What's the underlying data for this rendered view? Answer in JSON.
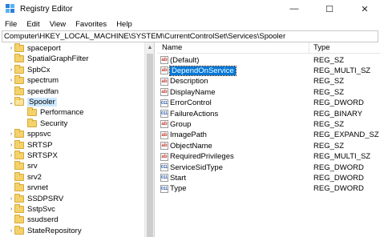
{
  "window": {
    "title": "Registry Editor",
    "minimize": "—",
    "maximize": "☐",
    "close": "✕"
  },
  "menu": [
    "File",
    "Edit",
    "View",
    "Favorites",
    "Help"
  ],
  "address": "Computer\\HKEY_LOCAL_MACHINE\\SYSTEM\\CurrentControlSet\\Services\\Spooler",
  "tree": [
    {
      "label": "spaceport",
      "chevron": "›",
      "indent": 0
    },
    {
      "label": "SpatialGraphFilter",
      "chevron": "",
      "indent": 0
    },
    {
      "label": "SpbCx",
      "chevron": "›",
      "indent": 0
    },
    {
      "label": "spectrum",
      "chevron": "›",
      "indent": 0
    },
    {
      "label": "speedfan",
      "chevron": "",
      "indent": 0
    },
    {
      "label": "Spooler",
      "chevron": "⌄",
      "indent": 0,
      "selected": true
    },
    {
      "label": "Performance",
      "chevron": "",
      "indent": 1
    },
    {
      "label": "Security",
      "chevron": "",
      "indent": 1
    },
    {
      "label": "sppsvc",
      "chevron": "›",
      "indent": 0
    },
    {
      "label": "SRTSP",
      "chevron": "›",
      "indent": 0
    },
    {
      "label": "SRTSPX",
      "chevron": "›",
      "indent": 0
    },
    {
      "label": "srv",
      "chevron": "",
      "indent": 0
    },
    {
      "label": "srv2",
      "chevron": "",
      "indent": 0
    },
    {
      "label": "srvnet",
      "chevron": "",
      "indent": 0
    },
    {
      "label": "SSDPSRV",
      "chevron": "›",
      "indent": 0
    },
    {
      "label": "SstpSvc",
      "chevron": "›",
      "indent": 0
    },
    {
      "label": "ssudserd",
      "chevron": "",
      "indent": 0
    },
    {
      "label": "StateRepository",
      "chevron": "›",
      "indent": 0
    }
  ],
  "columns": {
    "name": "Name",
    "type": "Type"
  },
  "values": [
    {
      "name": "(Default)",
      "type": "REG_SZ",
      "icon": "ab"
    },
    {
      "name": "DependOnService",
      "type": "REG_MULTI_SZ",
      "icon": "ab",
      "selected": true
    },
    {
      "name": "Description",
      "type": "REG_SZ",
      "icon": "ab"
    },
    {
      "name": "DisplayName",
      "type": "REG_SZ",
      "icon": "ab"
    },
    {
      "name": "ErrorControl",
      "type": "REG_DWORD",
      "icon": "bin"
    },
    {
      "name": "FailureActions",
      "type": "REG_BINARY",
      "icon": "bin"
    },
    {
      "name": "Group",
      "type": "REG_SZ",
      "icon": "ab"
    },
    {
      "name": "ImagePath",
      "type": "REG_EXPAND_SZ",
      "icon": "ab"
    },
    {
      "name": "ObjectName",
      "type": "REG_SZ",
      "icon": "ab"
    },
    {
      "name": "RequiredPrivileges",
      "type": "REG_MULTI_SZ",
      "icon": "ab"
    },
    {
      "name": "ServiceSidType",
      "type": "REG_DWORD",
      "icon": "bin"
    },
    {
      "name": "Start",
      "type": "REG_DWORD",
      "icon": "bin"
    },
    {
      "name": "Type",
      "type": "REG_DWORD",
      "icon": "bin"
    }
  ],
  "icon_glyphs": {
    "ab": "ab",
    "bin": "011"
  }
}
